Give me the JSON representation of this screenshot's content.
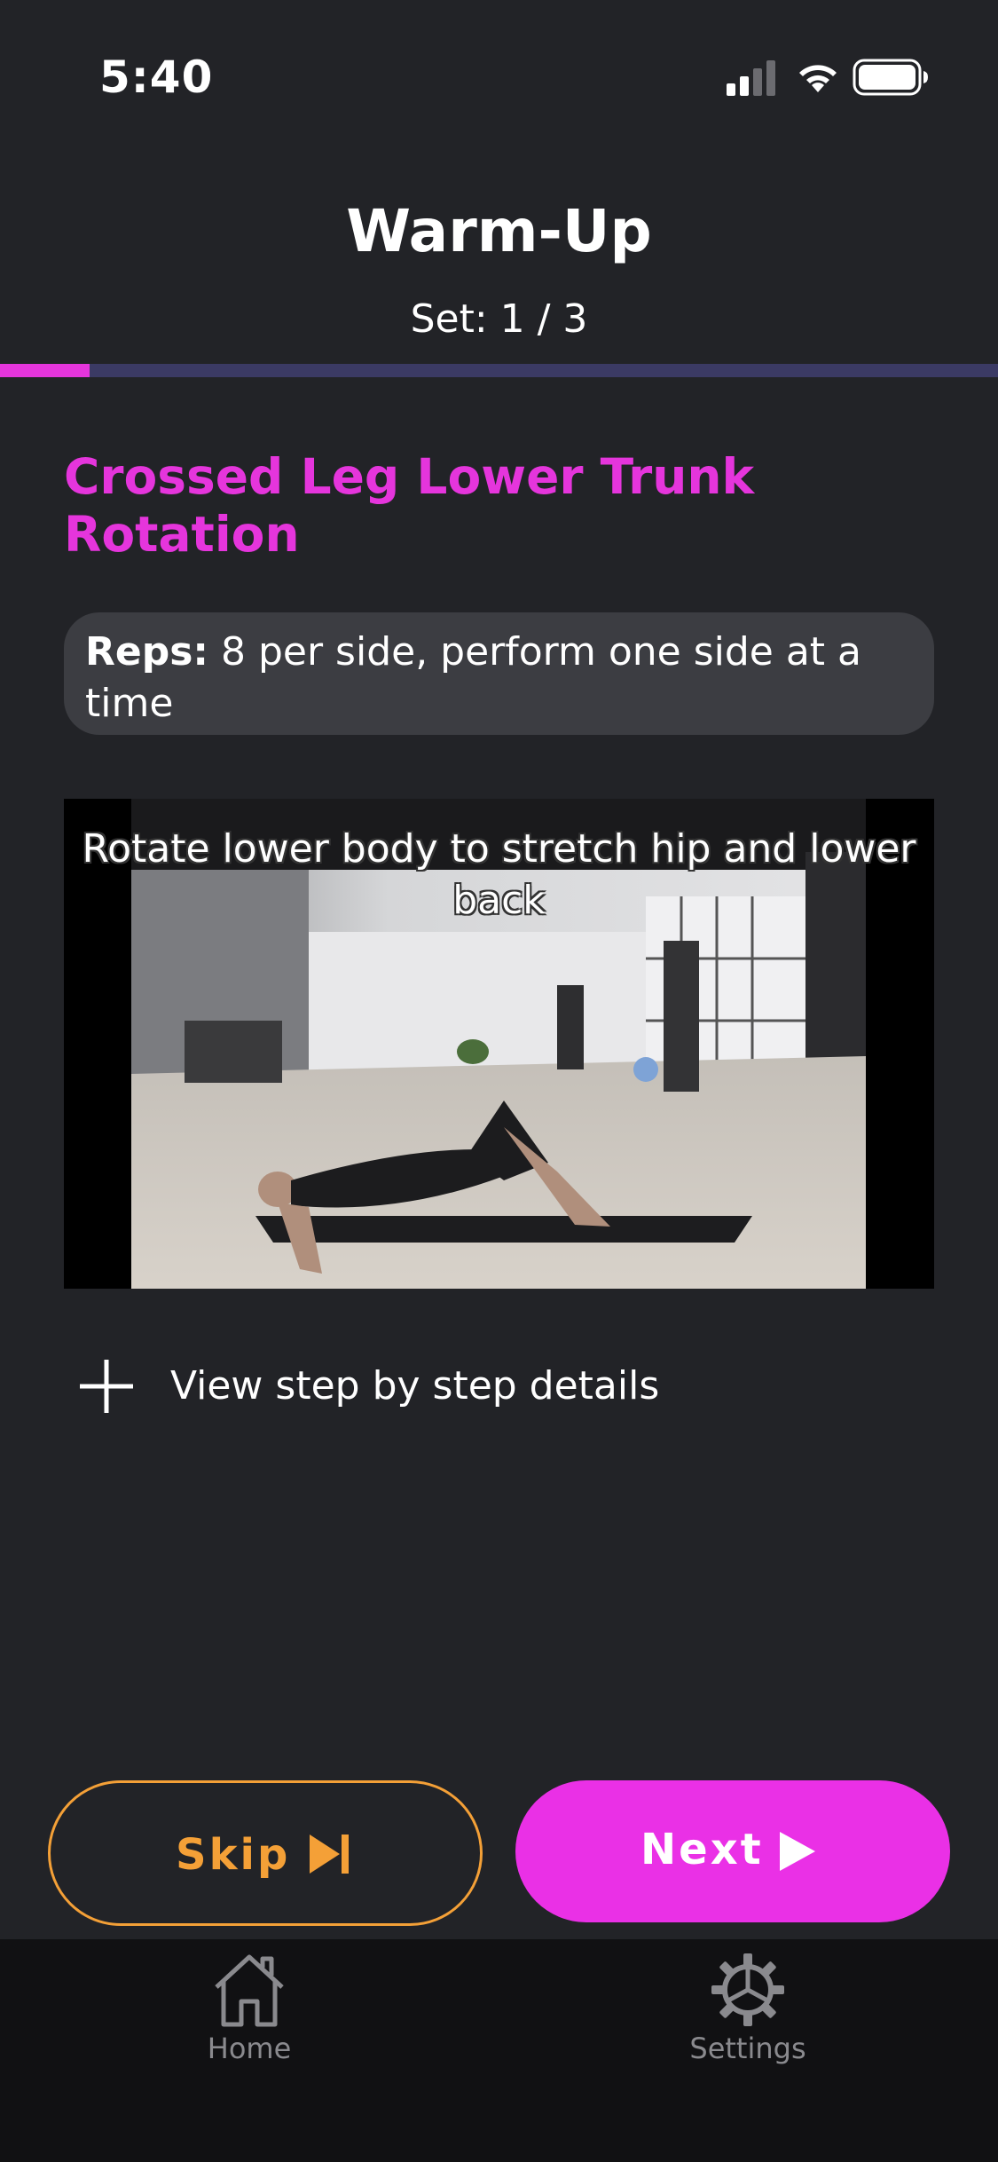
{
  "status_bar": {
    "time": "5:40",
    "icons": [
      "cellular-signal-icon",
      "wifi-icon",
      "battery-icon"
    ]
  },
  "header": {
    "title": "Warm-Up",
    "set_label": "Set: 1 / 3"
  },
  "progress": {
    "fraction": 0.09,
    "fill_color": "#e535dc",
    "track_color": "#3b3a64"
  },
  "exercise": {
    "title": "Crossed Leg Lower Trunk Rotation",
    "reps_label": "Reps:",
    "reps_text": " 8 per side, perform one side at a time",
    "video_caption": "Rotate lower body to stretch hip and lower back",
    "details_label": "View step by step details"
  },
  "actions": {
    "skip_label": "Skip",
    "next_label": "Next"
  },
  "tab_bar": {
    "items": [
      {
        "label": "Home",
        "icon": "home-icon"
      },
      {
        "label": "Settings",
        "icon": "gear-icon"
      }
    ]
  },
  "colors": {
    "background": "#222327",
    "accent": "#e535dc",
    "skip": "#f4a037"
  }
}
